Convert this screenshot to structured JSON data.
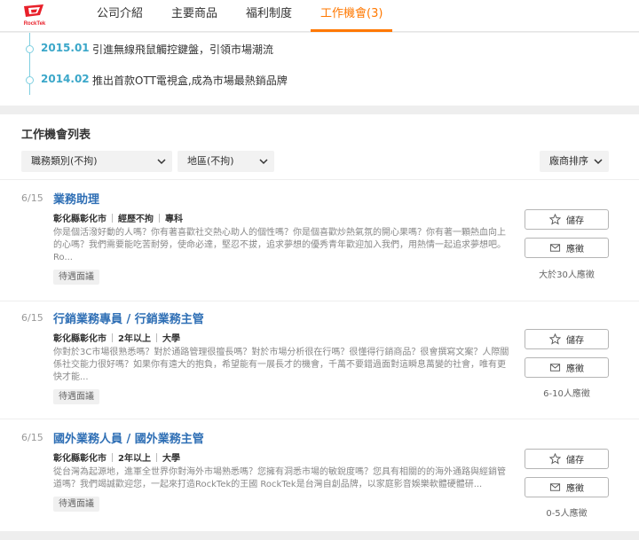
{
  "header": {
    "brand": "RockTek",
    "nav": [
      {
        "label": "公司介紹",
        "active": false
      },
      {
        "label": "主要商品",
        "active": false
      },
      {
        "label": "福利制度",
        "active": false
      },
      {
        "label": "工作機會(3)",
        "active": true
      }
    ]
  },
  "timeline": [
    {
      "date": "2015.01",
      "text": "引進無線飛鼠觸控鍵盤，引領市場潮流"
    },
    {
      "date": "2014.02",
      "text": "推出首款OTT電視盒,成為市場最熱銷品牌"
    }
  ],
  "jobs_section": {
    "title": "工作機會列表",
    "filter_category": "職務類別(不拘)",
    "filter_area": "地區(不拘)",
    "sort": "廠商排序",
    "save_label": "儲存",
    "apply_label": "應徵"
  },
  "jobs": [
    {
      "date": "6/15",
      "title": "業務助理",
      "location": "彰化縣彰化市",
      "experience": "經歷不拘",
      "education": "專科",
      "description": "你是個活潑好動的人嗎？你有著喜歡社交熱心助人的個性嗎？你是個喜歡炒熱氣氛的開心果嗎？你有著一顆熱血向上的心嗎？我們需要能吃苦耐勞，使命必達，堅忍不拔，追求夢想的優秀青年歡迎加入我們，用熱情一起追求夢想吧。Ro...",
      "tag": "待遇面議",
      "applicants": "大於30人應徵"
    },
    {
      "date": "6/15",
      "title": "行銷業務專員 / 行銷業務主管",
      "location": "彰化縣彰化市",
      "experience": "2年以上",
      "education": "大學",
      "description": "你對於3C市場很熟悉嗎？對於通路管理很擅長嗎？對於市場分析很在行嗎？很懂得行銷商品？很會撰寫文案？人際關係社交能力很好嗎？如果你有遠大的抱負，希望能有一展長才的機會，千萬不要錯過面對這瞬息萬變的社會，唯有更快才能...",
      "tag": "待遇面議",
      "applicants": "6-10人應徵"
    },
    {
      "date": "6/15",
      "title": "國外業務人員 / 國外業務主管",
      "location": "彰化縣彰化市",
      "experience": "2年以上",
      "education": "大學",
      "description": "從台灣為起源地，進軍全世界你對海外市場熟悉嗎？您擁有洞悉市場的敏銳度嗎？您具有相關的的海外通路與經銷管道嗎？我們竭誠歡迎您，一起來打造RockTek的王國 RockTek是台灣自創品牌，以家庭影音娛樂軟體硬體研...",
      "tag": "待遇面議",
      "applicants": "0-5人應徵"
    }
  ],
  "colors": {
    "accent": "#ff7800",
    "title_blue": "#2f6fb5",
    "timeline": "#3ba7c9",
    "logo_red": "#e8202a"
  }
}
